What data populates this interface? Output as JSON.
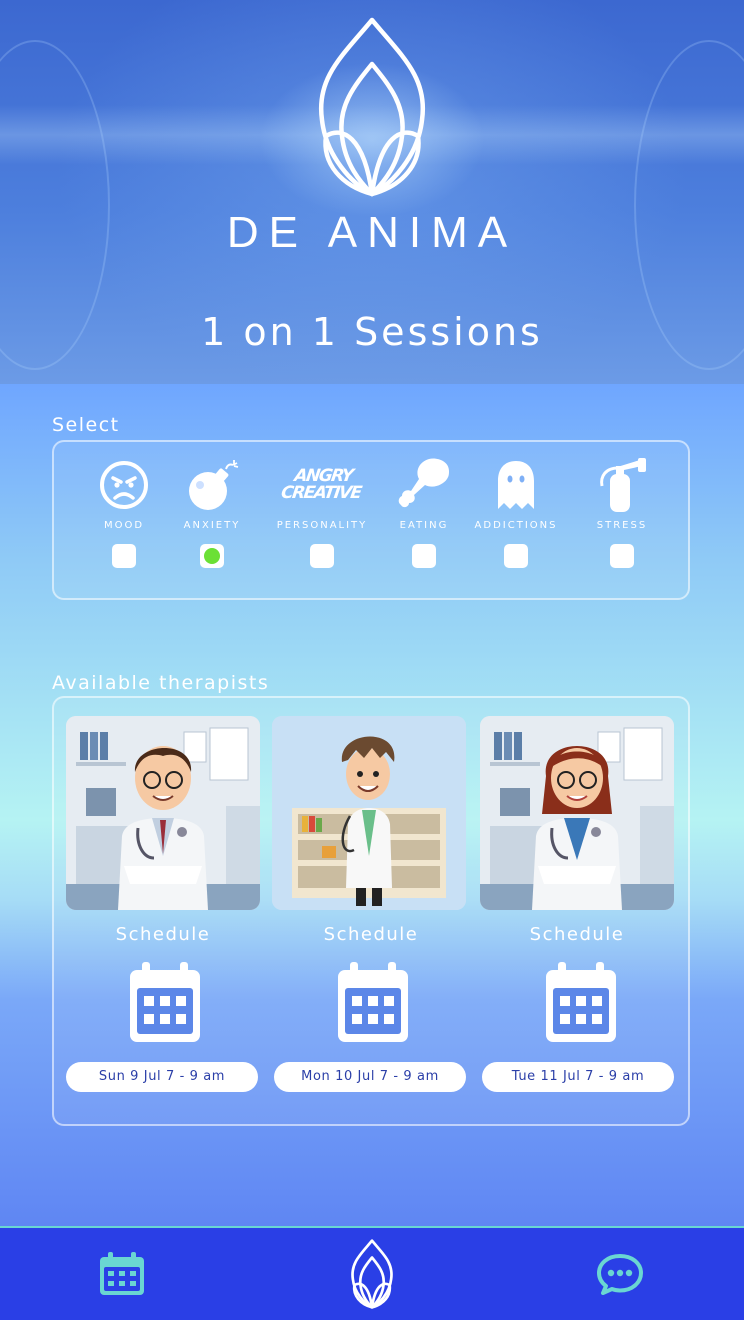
{
  "app": {
    "brand": "DE ANIMA",
    "subtitle": "1 on 1 Sessions"
  },
  "select": {
    "label": "Select",
    "categories": [
      {
        "label": "MOOD",
        "icon": "angry-face-icon",
        "checked": false
      },
      {
        "label": "ANXIETY",
        "icon": "bomb-icon",
        "checked": true
      },
      {
        "label": "PERSONALITY",
        "icon": "angry-creative-icon",
        "checked": false,
        "icon_text": "ANGRY CREATIVE"
      },
      {
        "label": "EATING",
        "icon": "meat-drumstick-icon",
        "checked": false
      },
      {
        "label": "ADDICTIONS",
        "icon": "ghost-icon",
        "checked": false
      },
      {
        "label": "STRESS",
        "icon": "fire-extinguisher-icon",
        "checked": false
      }
    ],
    "checked_color": "#6be035"
  },
  "therapists": {
    "label": "Available therapists",
    "items": [
      {
        "schedule_label": "Schedule",
        "slot": "Sun 9 Jul 7 - 9 am"
      },
      {
        "schedule_label": "Schedule",
        "slot": "Mon 10 Jul 7 - 9 am"
      },
      {
        "schedule_label": "Schedule",
        "slot": "Tue 11 Jul 7 - 9 am"
      }
    ]
  },
  "nav": {
    "items": [
      {
        "name": "calendar-icon"
      },
      {
        "name": "de-anima-logo-icon"
      },
      {
        "name": "chat-bubble-icon"
      }
    ],
    "accent": "#6ad6d2",
    "background": "#2a3fe6"
  }
}
